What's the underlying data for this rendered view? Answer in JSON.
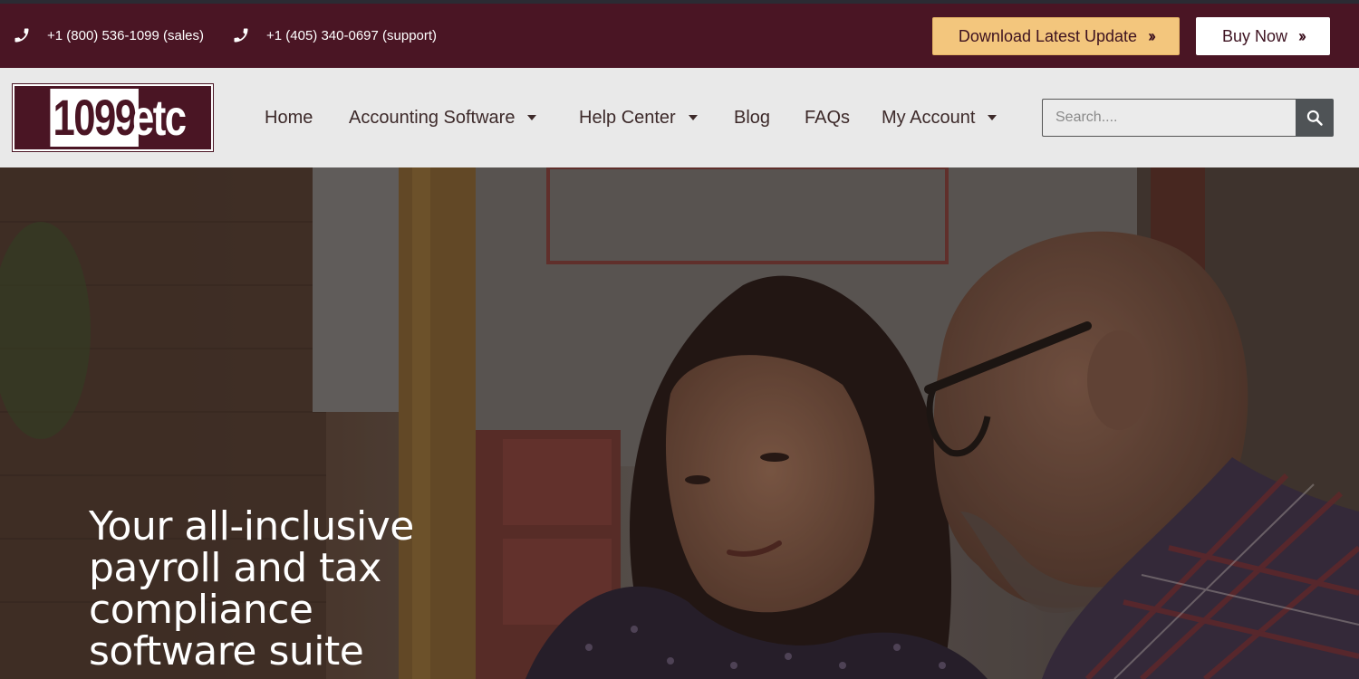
{
  "topbar": {
    "sales_phone": "+1 (800) 536-1099 (sales)",
    "support_phone": "+1 (405) 340-0697 (support)",
    "phone_icon": "phone-icon",
    "download_label": "Download Latest Update",
    "buy_label": "Buy Now",
    "button_icon": "double-chevron-right-icon"
  },
  "logo": {
    "number": "1099",
    "suffix": "etc"
  },
  "nav": {
    "items": [
      {
        "label": "Home",
        "has_dropdown": false
      },
      {
        "label": "Accounting Software",
        "has_dropdown": true
      },
      {
        "label": "Help Center",
        "has_dropdown": true
      },
      {
        "label": "Blog",
        "has_dropdown": false
      },
      {
        "label": "FAQs",
        "has_dropdown": false
      },
      {
        "label": "My Account",
        "has_dropdown": true
      }
    ]
  },
  "search": {
    "placeholder": "Search....",
    "value": "",
    "icon": "search-icon"
  },
  "hero": {
    "title": "Your all-inclusive payroll and tax compliance software suite",
    "image": "photo of two people looking at a screen"
  },
  "colors": {
    "brand_maroon": "#4a1524",
    "download_button": "#f3c67d",
    "nav_background": "#e9e9e9",
    "search_button": "#4f5356"
  }
}
